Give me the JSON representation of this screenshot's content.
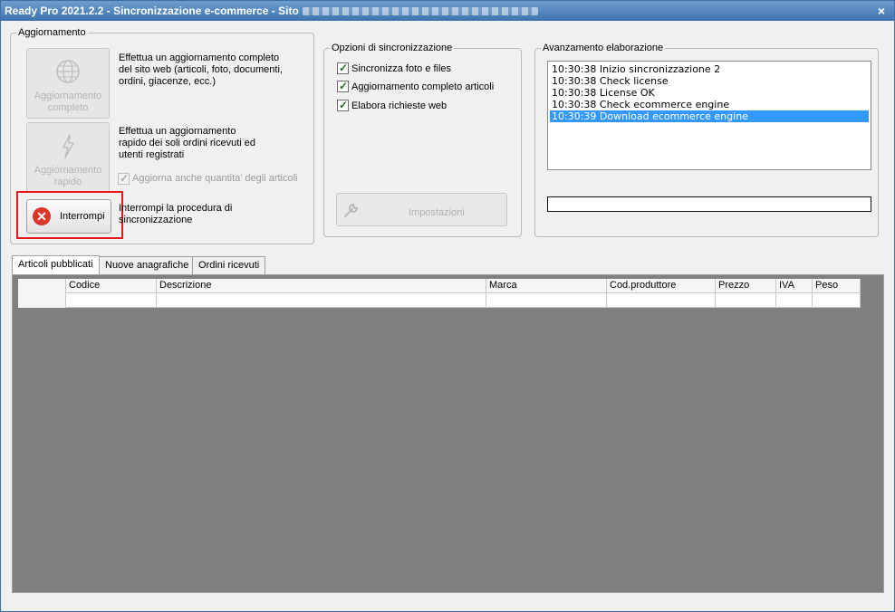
{
  "window": {
    "title": "Ready Pro 2021.2.2 - Sincronizzazione e-commerce - Sito",
    "close_glyph": "×"
  },
  "aggiornamento": {
    "label": "Aggiornamento",
    "full_button": {
      "label": "Aggiornamento completo",
      "icon": "globe-icon",
      "description": "Effettua un aggiornamento completo del sito web (articoli, foto, documenti, ordini, giacenze, ecc.)"
    },
    "quick_button": {
      "label": "Aggiornamento rapido",
      "icon": "lightning-icon",
      "description": "Effettua un aggiornamento rapido dei soli ordini ricevuti ed utenti registrati"
    },
    "update_qty_checkbox": {
      "label": "Aggiorna anche quantita' degli articoli",
      "checked": true
    },
    "stop_button": {
      "label": "Interrompi",
      "icon": "stop-icon",
      "description": "Interrompi la procedura di sincronizzazione"
    }
  },
  "options": {
    "label": "Opzioni di sincronizzazione",
    "items": [
      {
        "label": "Sincronizza foto e files",
        "checked": true
      },
      {
        "label": "Aggiornamento completo articoli",
        "checked": true
      },
      {
        "label": "Elabora richieste web",
        "checked": true
      }
    ],
    "settings_button": {
      "label": "Impostazioni",
      "icon": "wrench-icon"
    }
  },
  "progress": {
    "label": "Avanzamento elaborazione",
    "log": [
      {
        "text": "10:30:38 Inizio sincronizzazione 2",
        "selected": false
      },
      {
        "text": "10:30:38 Check license",
        "selected": false
      },
      {
        "text": "10:30:38 License OK",
        "selected": false
      },
      {
        "text": "10:30:38 Check ecommerce engine",
        "selected": false
      },
      {
        "text": "10:30:39 Download ecommerce engine",
        "selected": true
      }
    ],
    "bar_value": 0
  },
  "tabs": [
    {
      "label": "Articoli pubblicati",
      "active": true
    },
    {
      "label": "Nuove anagrafiche",
      "active": false
    },
    {
      "label": "Ordini ricevuti",
      "active": false
    }
  ],
  "grid": {
    "columns": [
      "Codice",
      "Descrizione",
      "Marca",
      "Cod.produttore",
      "Prezzo",
      "IVA",
      "Peso"
    ]
  },
  "colors": {
    "accent_title": "#3f73ad",
    "selection": "#3399ff",
    "stop": "#d9362b",
    "highlight": "#e21a1a"
  }
}
